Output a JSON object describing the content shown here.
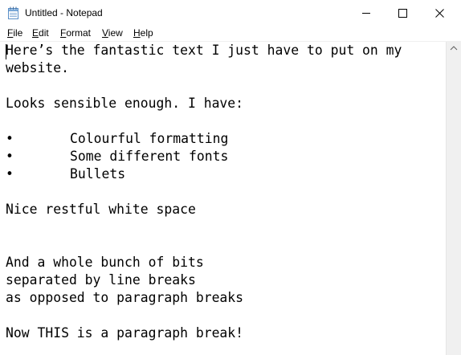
{
  "window": {
    "title": "Untitled - Notepad",
    "icon": "notepad-icon",
    "controls": {
      "minimize": "minimize-icon",
      "maximize": "maximize-icon",
      "close": "close-icon"
    }
  },
  "menu": {
    "items": [
      {
        "accel": "F",
        "rest": "ile"
      },
      {
        "accel": "E",
        "rest": "dit"
      },
      {
        "accel": "F",
        "rest": "ormat"
      },
      {
        "accel": "V",
        "rest": "iew"
      },
      {
        "accel": "H",
        "rest": "elp"
      }
    ]
  },
  "document": {
    "lines": [
      "Here’s the fantastic text I just have to put on my",
      "website.",
      "",
      "Looks sensible enough. I have:",
      "",
      "",
      "",
      "",
      "",
      "Nice restful white space",
      "",
      "",
      "And a whole bunch of bits",
      "separated by line breaks",
      "as opposed to paragraph breaks",
      "",
      "Now THIS is a paragraph break!"
    ],
    "bullet_char": "•",
    "bullets": [
      "Colourful formatting",
      "Some different fonts",
      "Bullets"
    ]
  },
  "colors": {
    "text": "#000000",
    "background": "#ffffff",
    "scrollbar": "#f0f0f0"
  }
}
